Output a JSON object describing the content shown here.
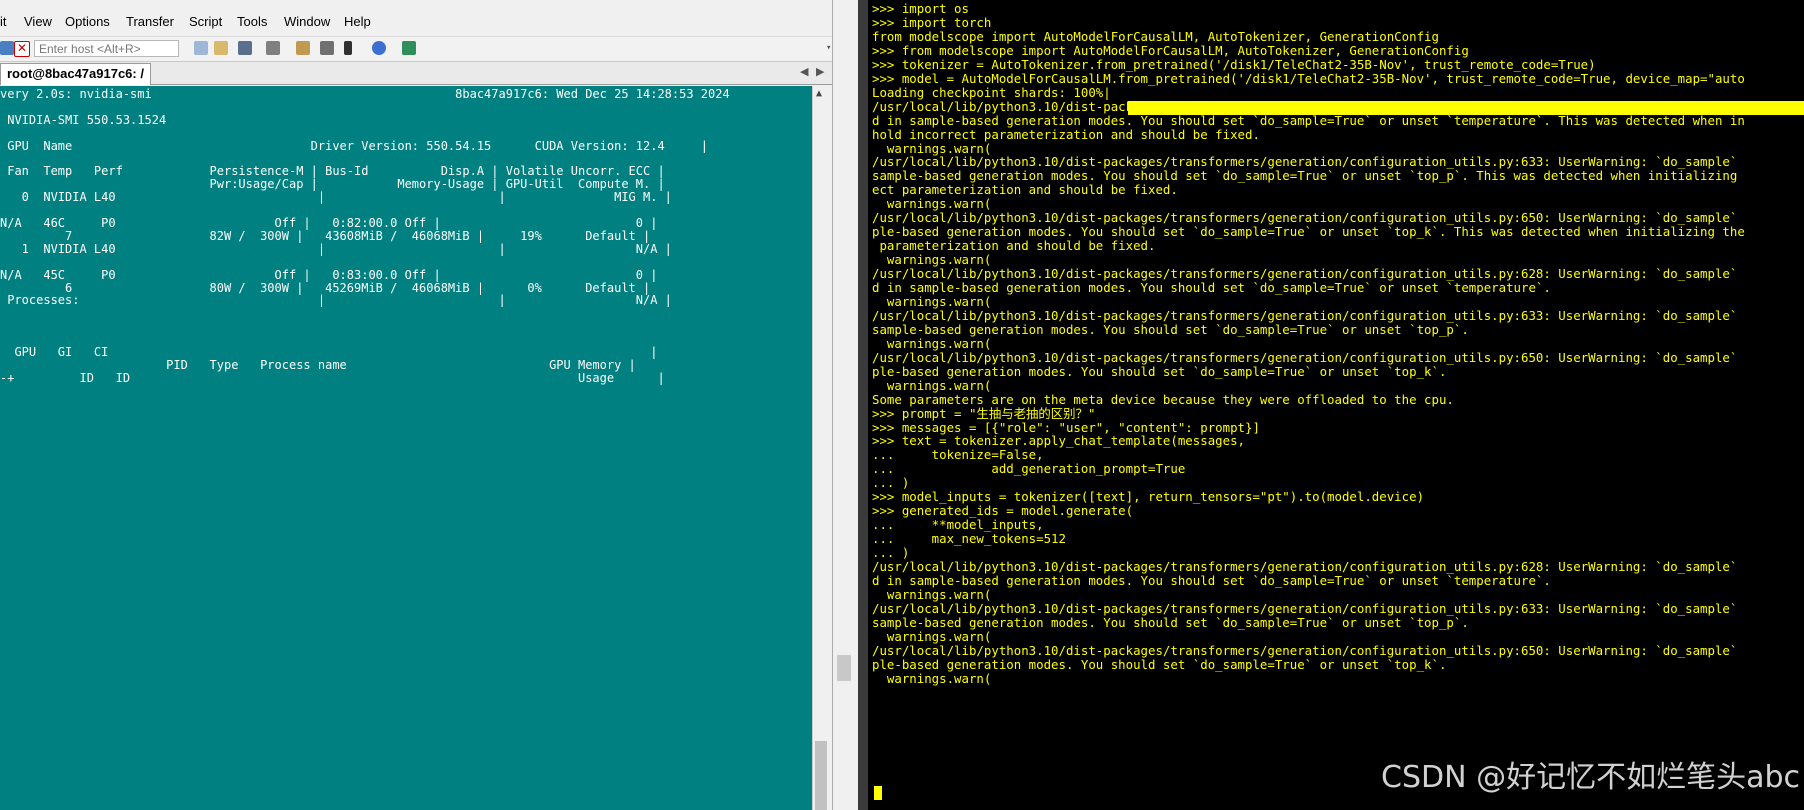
{
  "menubar": {
    "items": [
      "it",
      "View",
      "Options",
      "Transfer",
      "Script",
      "Tools",
      "Window",
      "Help"
    ]
  },
  "toolbar": {
    "host_placeholder": "Enter host <Alt+R>"
  },
  "tabs": {
    "active_label": "root@8bac47a917c6: /",
    "nav_prev": "◀",
    "nav_next": "▶"
  },
  "left_terminal": {
    "lines": [
      "very 2.0s: nvidia-smi                                          8bac47a917c6: Wed Dec 25 14:28:53 2024",
      "",
      " NVIDIA-SMI 550.53.1524",
      "",
      " GPU  Name                                 Driver Version: 550.54.15      CUDA Version: 12.4     |",
      "",
      " Fan  Temp   Perf            Persistence-M | Bus-Id          Disp.A | Volatile Uncorr. ECC |",
      "                             Pwr:Usage/Cap |           Memory-Usage | GPU-Util  Compute M. |",
      "   0  NVIDIA L40                            |                        |               MIG M. |",
      "",
      "N/A   46C     P0                      Off |   0:82:00.0 Off |                           0 |",
      "         7                   82W /  300W |   43608MiB /  46068MiB |     19%      Default |",
      "   1  NVIDIA L40                            |                        |                  N/A |",
      "",
      "N/A   45C     P0                      Off |   0:83:00.0 Off |                           0 |",
      "         6                   80W /  300W |   45269MiB /  46068MiB |      0%      Default |",
      " Processes:                                 |                        |                  N/A |",
      "",
      "",
      "",
      "  GPU   GI   CI                                                                           |",
      "                       PID   Type   Process name                            GPU Memory |",
      "-+         ID   ID                                                              Usage      |"
    ]
  },
  "right_terminal": {
    "lines": [
      ">>> import os",
      ">>> import torch",
      "from modelscope import AutoModelForCausalLM, AutoTokenizer, GenerationConfig",
      ">>> from modelscope import AutoModelForCausalLM, AutoTokenizer, GenerationConfig",
      ">>> tokenizer = AutoTokenizer.from_pretrained('/disk1/TeleChat2-35B-Nov', trust_remote_code=True)",
      ">>> model = AutoModelForCausalLM.from_pretrained('/disk1/TeleChat2-35B-Nov', trust_remote_code=True, device_map=\"auto",
      "Loading checkpoint shards: 100%|",
      "/usr/local/lib/python3.10/dist-packages/transformers/generation/configuration_utils.py:628: UserWarning: `do_sample`",
      "d in sample-based generation modes. You should set `do_sample=True` or unset `temperature`. This was detected when in",
      "hold incorrect parameterization and should be fixed.",
      "  warnings.warn(",
      "/usr/local/lib/python3.10/dist-packages/transformers/generation/configuration_utils.py:633: UserWarning: `do_sample`",
      "sample-based generation modes. You should set `do_sample=True` or unset `top_p`. This was detected when initializing",
      "ect parameterization and should be fixed.",
      "  warnings.warn(",
      "/usr/local/lib/python3.10/dist-packages/transformers/generation/configuration_utils.py:650: UserWarning: `do_sample`",
      "ple-based generation modes. You should set `do_sample=True` or unset `top_k`. This was detected when initializing the",
      " parameterization and should be fixed.",
      "  warnings.warn(",
      "/usr/local/lib/python3.10/dist-packages/transformers/generation/configuration_utils.py:628: UserWarning: `do_sample`",
      "d in sample-based generation modes. You should set `do_sample=True` or unset `temperature`.",
      "  warnings.warn(",
      "/usr/local/lib/python3.10/dist-packages/transformers/generation/configuration_utils.py:633: UserWarning: `do_sample`",
      "sample-based generation modes. You should set `do_sample=True` or unset `top_p`.",
      "  warnings.warn(",
      "/usr/local/lib/python3.10/dist-packages/transformers/generation/configuration_utils.py:650: UserWarning: `do_sample`",
      "ple-based generation modes. You should set `do_sample=True` or unset `top_k`.",
      "  warnings.warn(",
      "Some parameters are on the meta device because they were offloaded to the cpu.",
      ">>> prompt = \"生抽与老抽的区别？\"",
      ">>> messages = [{\"role\": \"user\", \"content\": prompt}]",
      ">>> text = tokenizer.apply_chat_template(messages,",
      "...     tokenize=False,",
      "...             add_generation_prompt=True",
      "... )",
      ">>> model_inputs = tokenizer([text], return_tensors=\"pt\").to(model.device)",
      ">>> generated_ids = model.generate(",
      "...     **model_inputs,",
      "...     max_new_tokens=512",
      "... )",
      "/usr/local/lib/python3.10/dist-packages/transformers/generation/configuration_utils.py:628: UserWarning: `do_sample`",
      "d in sample-based generation modes. You should set `do_sample=True` or unset `temperature`.",
      "  warnings.warn(",
      "/usr/local/lib/python3.10/dist-packages/transformers/generation/configuration_utils.py:633: UserWarning: `do_sample`",
      "sample-based generation modes. You should set `do_sample=True` or unset `top_p`.",
      "  warnings.warn(",
      "/usr/local/lib/python3.10/dist-packages/transformers/generation/configuration_utils.py:650: UserWarning: `do_sample`",
      "ple-based generation modes. You should set `do_sample=True` or unset `top_k`.",
      "  warnings.warn("
    ]
  },
  "watermark": "CSDN @好记忆不如烂笔头abc",
  "colors": {
    "left_terminal_bg": "#008080",
    "right_terminal_bg": "#000000",
    "right_terminal_text": "#ffff00",
    "left_terminal_text": "#ffffff"
  }
}
